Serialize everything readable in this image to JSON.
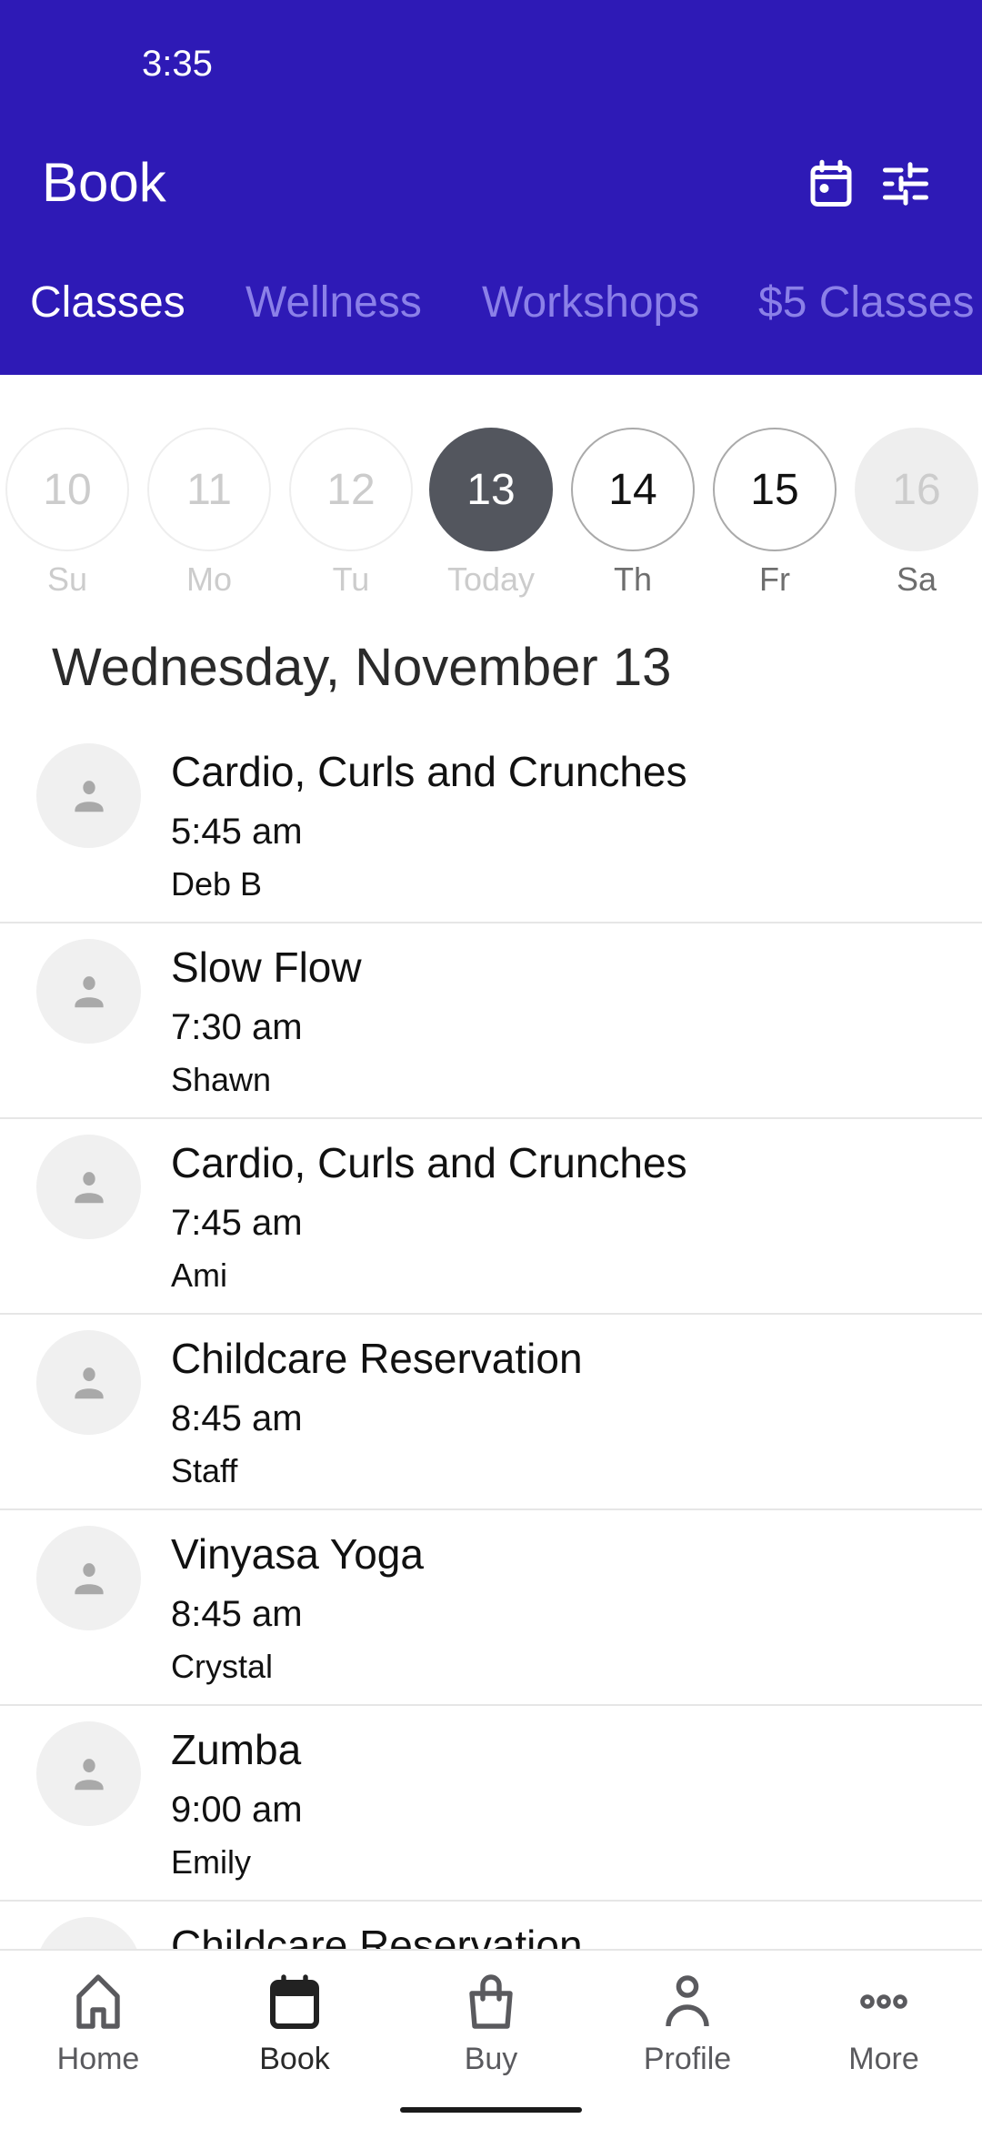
{
  "status_bar": {
    "time": "3:35"
  },
  "header": {
    "title": "Book",
    "icons": [
      "calendar-icon",
      "filter-sliders-icon"
    ]
  },
  "tabs": [
    {
      "label": "Classes",
      "active": true
    },
    {
      "label": "Wellness",
      "active": false
    },
    {
      "label": "Workshops",
      "active": false
    },
    {
      "label": "$5 Classes",
      "active": false
    }
  ],
  "days": [
    {
      "number": "10",
      "label": "Su",
      "state": "past"
    },
    {
      "number": "11",
      "label": "Mo",
      "state": "past"
    },
    {
      "number": "12",
      "label": "Tu",
      "state": "past"
    },
    {
      "number": "13",
      "label": "Today",
      "state": "selected"
    },
    {
      "number": "14",
      "label": "Th",
      "state": "future"
    },
    {
      "number": "15",
      "label": "Fr",
      "state": "future"
    },
    {
      "number": "16",
      "label": "Sa",
      "state": "unavailable"
    }
  ],
  "date_heading": "Wednesday, November 13",
  "classes": [
    {
      "name": "Cardio, Curls and Crunches",
      "time": "5:45 am",
      "instructor": "Deb B"
    },
    {
      "name": "Slow Flow",
      "time": "7:30 am",
      "instructor": "Shawn"
    },
    {
      "name": "Cardio, Curls and Crunches",
      "time": "7:45 am",
      "instructor": "Ami"
    },
    {
      "name": "Childcare Reservation",
      "time": "8:45 am",
      "instructor": "Staff"
    },
    {
      "name": "Vinyasa Yoga",
      "time": "8:45 am",
      "instructor": "Crystal"
    },
    {
      "name": "Zumba",
      "time": "9:00 am",
      "instructor": "Emily"
    },
    {
      "name": "Childcare Reservation",
      "time": "",
      "instructor": ""
    }
  ],
  "bottom_nav": [
    {
      "label": "Home",
      "icon": "home-icon",
      "active": false
    },
    {
      "label": "Book",
      "icon": "calendar-icon",
      "active": true
    },
    {
      "label": "Buy",
      "icon": "shopping-bag-icon",
      "active": false
    },
    {
      "label": "Profile",
      "icon": "person-icon",
      "active": false
    },
    {
      "label": "More",
      "icon": "more-dots-icon",
      "active": false
    }
  ],
  "colors": {
    "brand": "#2e1ab6",
    "tab_inactive": "#8b80e8",
    "selected_day": "#53565e"
  }
}
